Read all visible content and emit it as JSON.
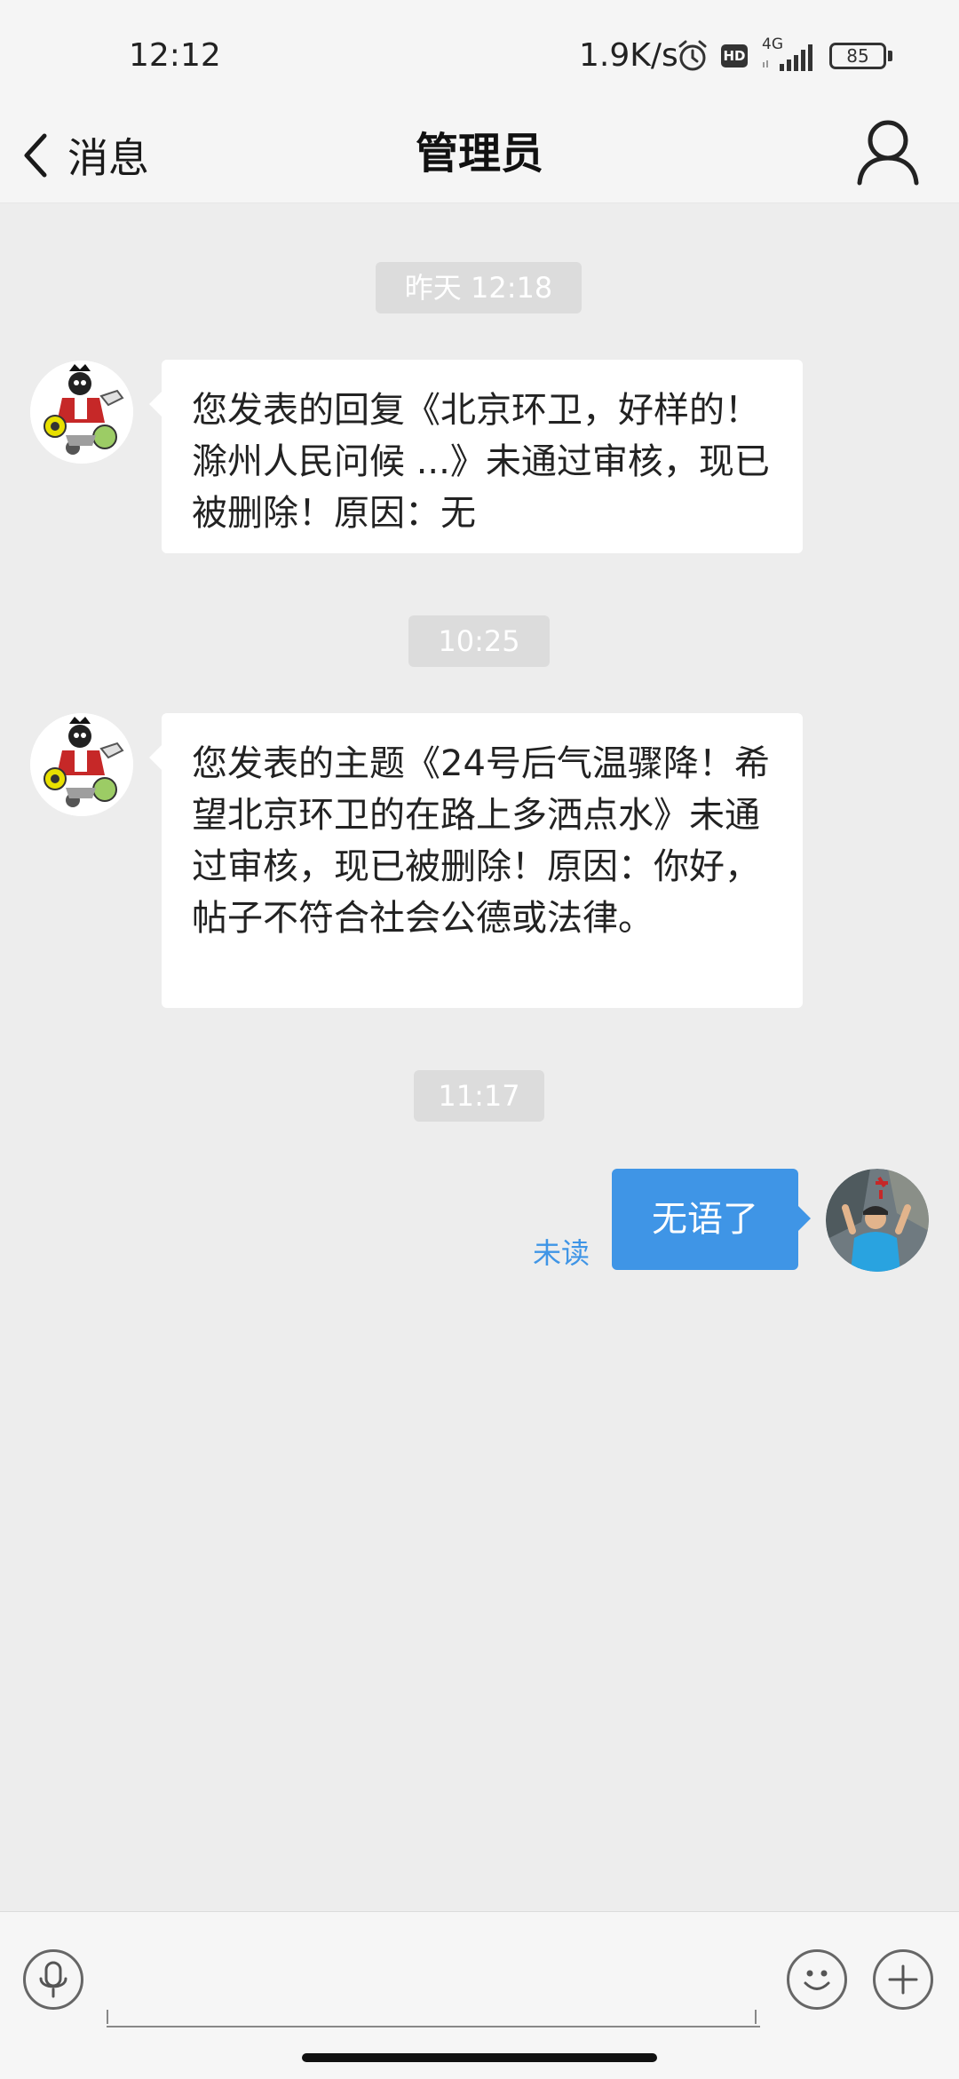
{
  "status_bar": {
    "time": "12:12",
    "net_speed": "1.9K/s",
    "hd_label": "HD",
    "network_type": "4G",
    "battery": "85",
    "icons": [
      "alarm-icon",
      "hd-icon",
      "signal-icon",
      "battery-icon"
    ]
  },
  "nav": {
    "back_label": "消息",
    "title": "管理员",
    "icons": [
      "back-chevron-icon",
      "profile-icon"
    ]
  },
  "messages": [
    {
      "timestamp": "昨天 12:18",
      "direction": "incoming",
      "avatar": "admin-mascot-avatar",
      "text": "您发表的回复《北京环卫，好样的！滁州人民问候 ...》未通过审核，现已被删除！原因：无"
    },
    {
      "timestamp": "10:25",
      "direction": "incoming",
      "avatar": "admin-mascot-avatar",
      "text": "您发表的主题《24号后气温骤降！希望北京环卫的在路上多洒点水》未通过审核，现已被删除！原因：你好，帖子不符合社会公德或法律。"
    },
    {
      "timestamp": "11:17",
      "direction": "outgoing",
      "avatar": "user-photo-avatar",
      "text": "无语了",
      "status": "未读"
    }
  ],
  "input_bar": {
    "placeholder": "",
    "icons": [
      "microphone-icon",
      "emoji-icon",
      "plus-icon"
    ]
  },
  "colors": {
    "background": "#ededed",
    "bar_background": "#f5f5f5",
    "accent": "#3f95e6",
    "timestamp_chip": "#dcdcdc"
  }
}
